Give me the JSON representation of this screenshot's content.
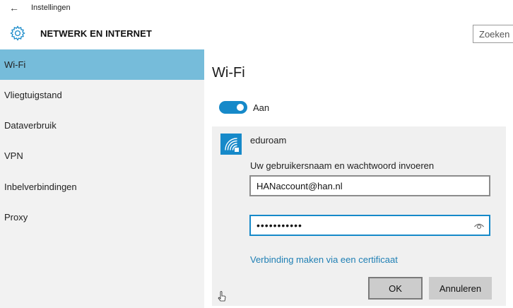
{
  "window": {
    "app_title": "Instellingen",
    "back_icon": "back-arrow-icon"
  },
  "header": {
    "icon": "gear-icon",
    "title": "NETWERK EN INTERNET",
    "search_value": "Zoeken"
  },
  "sidebar": {
    "items": [
      {
        "label": "Wi-Fi",
        "active": true
      },
      {
        "label": "Vliegtuigstand",
        "active": false
      },
      {
        "label": "Dataverbruik",
        "active": false
      },
      {
        "label": "VPN",
        "active": false
      },
      {
        "label": "Inbelverbindingen",
        "active": false
      },
      {
        "label": "Proxy",
        "active": false
      }
    ]
  },
  "main": {
    "title": "Wi-Fi",
    "toggle": {
      "state": "on",
      "label": "Aan"
    },
    "network": {
      "icon": "wifi-secured-icon",
      "name": "eduroam",
      "prompt": "Uw gebruikersnaam en wachtwoord invoeren",
      "username_value": "HANaccount@han.nl",
      "password_value": "•••••••••••",
      "certificate_link": "Verbinding maken via een certificaat",
      "ok_label": "OK",
      "cancel_label": "Annuleren"
    }
  },
  "colors": {
    "accent": "#1689c9",
    "active_nav": "#76bcda",
    "link": "#1f7fb4",
    "sidebar_bg": "#f2f2f2",
    "panel_bg": "#f0f0f0"
  }
}
